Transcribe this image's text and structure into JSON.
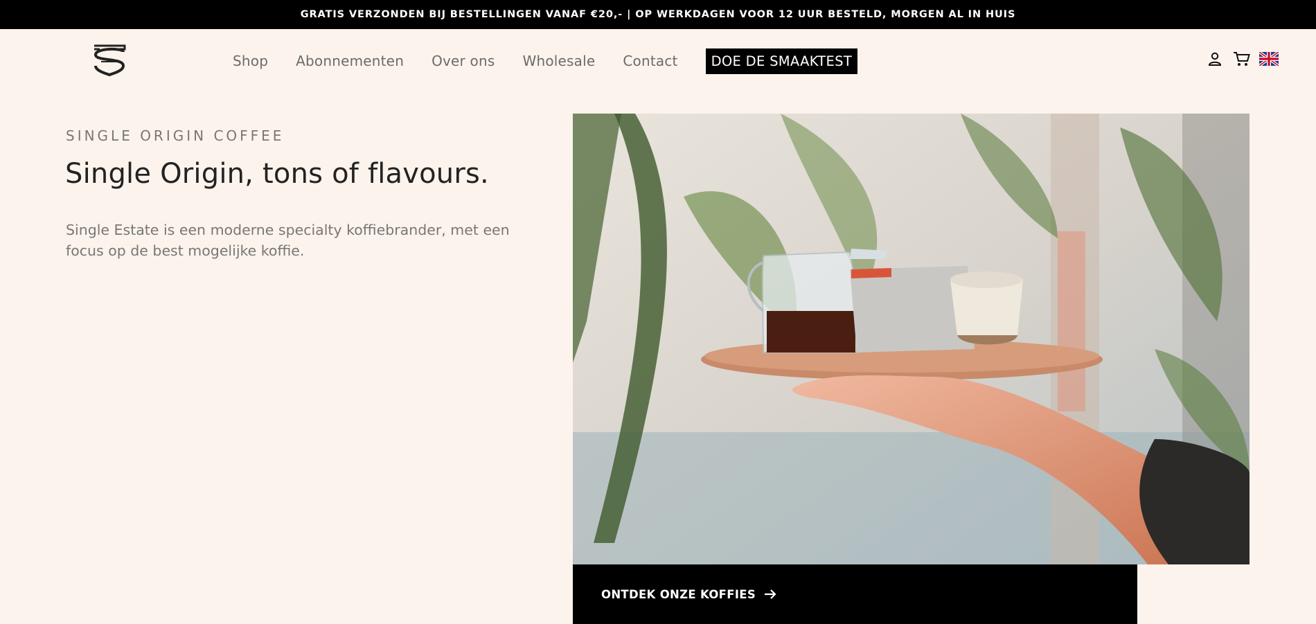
{
  "announcement": "GRATIS VERZONDEN BIJ BESTELLINGEN VANAF €20,- | OP WERKDAGEN VOOR 12 UUR BESTELD, MORGEN AL IN HUIS",
  "header": {
    "logo_icon": "single-estate-logo-icon",
    "nav": [
      "Shop",
      "Abonnementen",
      "Over ons",
      "Wholesale",
      "Contact"
    ],
    "cta": "DOE DE SMAAKTEST",
    "icons": [
      "account-icon",
      "cart-icon",
      "uk-flag-icon"
    ]
  },
  "hero": {
    "eyebrow": "SINGLE ORIGIN COFFEE",
    "title": "Single Origin, tons of flavours.",
    "intro": "Single Estate is een moderne specialty koffiebrander, met een focus op de best mogelijke koffie.",
    "image_icon": "hero-photo-coffee-tray",
    "button": "ONTDEK ONZE KOFFIES",
    "button_icon": "arrow-right-icon"
  },
  "colors": {
    "background": "#fcf3ec",
    "bar": "#000000",
    "text": "#222222",
    "muted": "#777777"
  }
}
